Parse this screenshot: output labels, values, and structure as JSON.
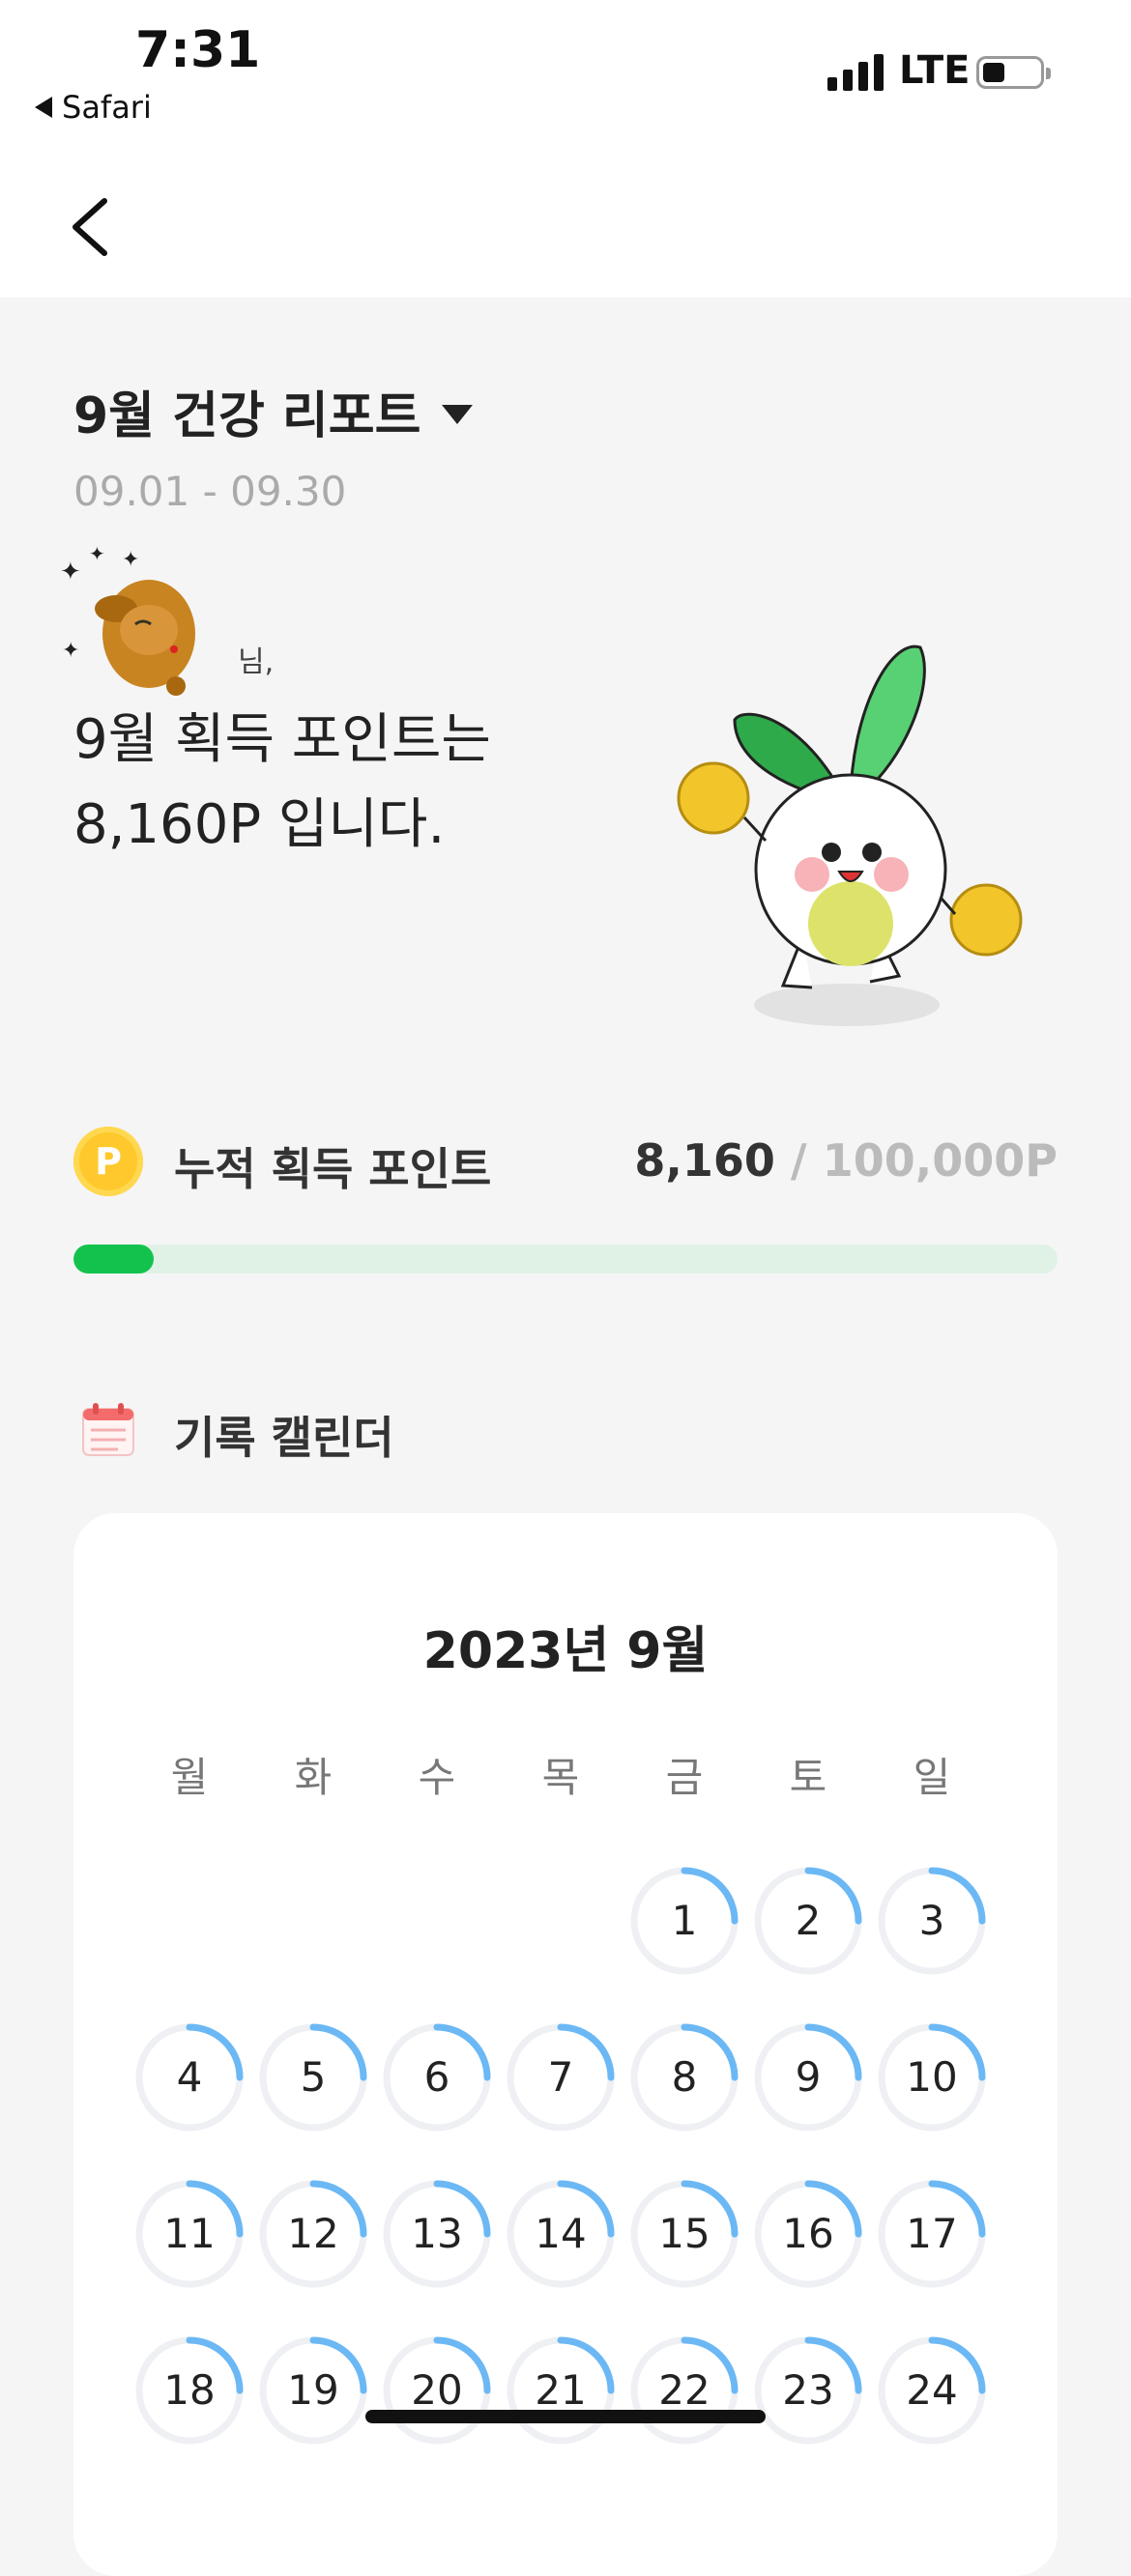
{
  "status": {
    "time": "7:31",
    "back_app": "Safari",
    "network": "LTE"
  },
  "report": {
    "title": "9월 건강 리포트",
    "date_range": "09.01 - 09.30",
    "greeting_suffix": "님,",
    "headline_line1": "9월 획득 포인트는",
    "headline_line2": "8,160P 입니다."
  },
  "points": {
    "label": "누적 획득 포인트",
    "coin_symbol": "P",
    "current": "8,160",
    "separator": " / ",
    "max": "100,000P",
    "progress_fraction": 0.0816,
    "fill_color": "#13c24d"
  },
  "calendar": {
    "section_title": "기록 캘린더",
    "month_label": "2023년 9월",
    "weekdays": [
      "월",
      "화",
      "수",
      "목",
      "금",
      "토",
      "일"
    ],
    "leading_blanks": 4,
    "visible_days": [
      "1",
      "2",
      "3",
      "4",
      "5",
      "6",
      "7",
      "8",
      "9",
      "10",
      "11",
      "12",
      "13",
      "14",
      "15",
      "16",
      "17",
      "18",
      "19",
      "20",
      "21",
      "22",
      "23",
      "24"
    ],
    "ring_color": "#6bb8f5",
    "ring_track_color": "#eef0f4",
    "ring_fraction": 0.25
  }
}
